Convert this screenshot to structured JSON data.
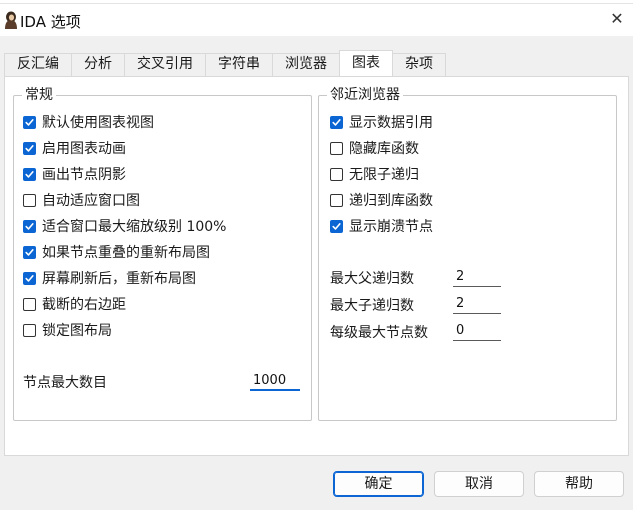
{
  "window": {
    "title": "IDA 选项",
    "close_glyph": "✕"
  },
  "tabs": [
    {
      "label": "反汇编",
      "active": false
    },
    {
      "label": "分析",
      "active": false
    },
    {
      "label": "交叉引用",
      "active": false
    },
    {
      "label": "字符串",
      "active": false
    },
    {
      "label": "浏览器",
      "active": false
    },
    {
      "label": "图表",
      "active": true
    },
    {
      "label": "杂项",
      "active": false
    }
  ],
  "general": {
    "title": "常规",
    "options": [
      {
        "label": "默认使用图表视图",
        "checked": true
      },
      {
        "label": "启用图表动画",
        "checked": true
      },
      {
        "label": "画出节点阴影",
        "checked": true
      },
      {
        "label": "自动适应窗口图",
        "checked": false
      },
      {
        "label": "适合窗口最大缩放级别 100%",
        "checked": true
      },
      {
        "label": "如果节点重叠的重新布局图",
        "checked": true
      },
      {
        "label": "屏幕刷新后，重新布局图",
        "checked": true
      },
      {
        "label": "截断的右边距",
        "checked": false
      },
      {
        "label": "锁定图布局",
        "checked": false
      }
    ],
    "max_nodes_label": "节点最大数目",
    "max_nodes_value": "1000"
  },
  "proximity": {
    "title": "邻近浏览器",
    "options": [
      {
        "label": "显示数据引用",
        "checked": true
      },
      {
        "label": "隐藏库函数",
        "checked": false
      },
      {
        "label": "无限子递归",
        "checked": false
      },
      {
        "label": "递归到库函数",
        "checked": false
      },
      {
        "label": "显示崩溃节点",
        "checked": true
      }
    ],
    "fields": [
      {
        "label": "最大父递归数",
        "value": "2"
      },
      {
        "label": "最大子递归数",
        "value": "2"
      },
      {
        "label": "每级最大节点数",
        "value": "0"
      }
    ]
  },
  "buttons": {
    "ok": "确定",
    "cancel": "取消",
    "help": "帮助"
  },
  "colors": {
    "accent": "#0b66d4",
    "dialog_bg": "#f0f0f0"
  }
}
